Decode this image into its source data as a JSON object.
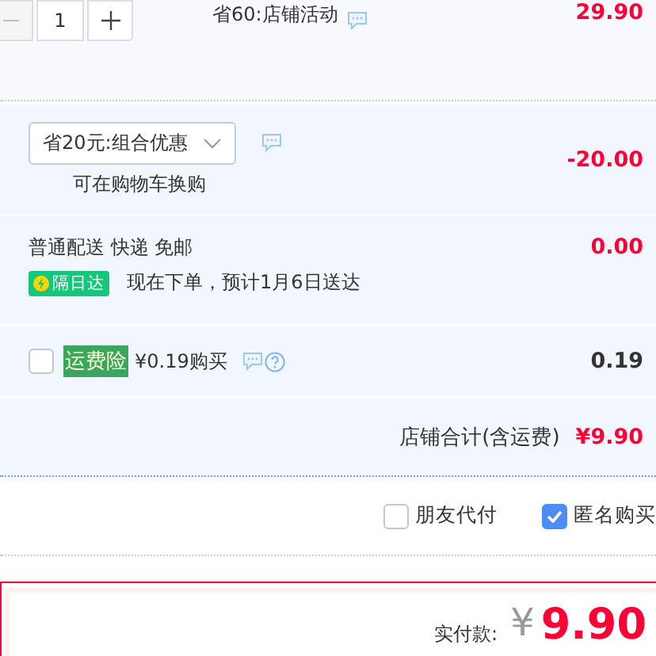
{
  "item": {
    "quantity": "1",
    "promo": "省60:店铺活动",
    "price": "29.90"
  },
  "combo": {
    "discount_select": "省20元:组合优惠",
    "note": "可在购物车换购",
    "amount": "-20.00"
  },
  "delivery": {
    "method": "普通配送 快递 免邮",
    "badge": "隔日达",
    "estimate": "现在下单，预计1月6日送达",
    "amount": "0.00"
  },
  "insurance": {
    "checked": false,
    "label": "运费险",
    "offer": "¥0.19购买",
    "amount": "0.19"
  },
  "store_total": {
    "label": "店铺合计(含运费)",
    "amount": "¥9.90"
  },
  "options": [
    {
      "label": "朋友代付",
      "checked": false
    },
    {
      "label": "匿名购买",
      "checked": true
    }
  ],
  "payment": {
    "label": "实付款:",
    "currency": "¥",
    "amount": "9.90"
  }
}
